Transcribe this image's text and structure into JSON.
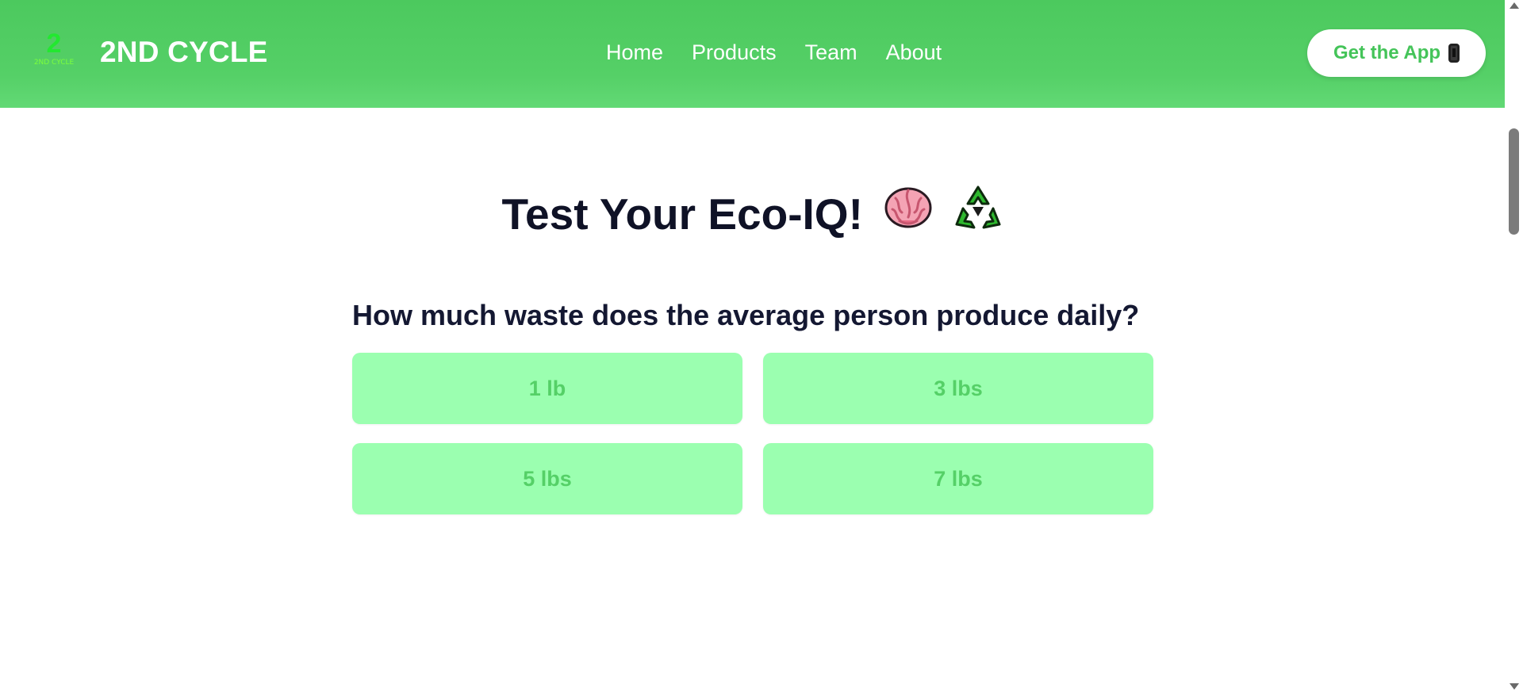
{
  "brand": {
    "logo_digit": "2",
    "logo_text": "2ND CYCLE",
    "name": "2ND CYCLE"
  },
  "nav": {
    "items": [
      {
        "label": "Home"
      },
      {
        "label": "Products"
      },
      {
        "label": "Team"
      },
      {
        "label": "About"
      }
    ],
    "cta_label": "Get the App",
    "cta_icon": "mobile-phone-icon"
  },
  "quiz": {
    "title": "Test Your Eco-IQ!",
    "title_icons": [
      "brain-icon",
      "recycle-icon"
    ],
    "question": "How much waste does the average person produce daily?",
    "answers": [
      {
        "label": "1 lb"
      },
      {
        "label": "3 lbs"
      },
      {
        "label": "5 lbs"
      },
      {
        "label": "7 lbs"
      }
    ]
  },
  "colors": {
    "nav_green": "#4cc95e",
    "answer_bg": "#9bffb0",
    "answer_text": "#55d067",
    "title_text": "#0f1226"
  }
}
